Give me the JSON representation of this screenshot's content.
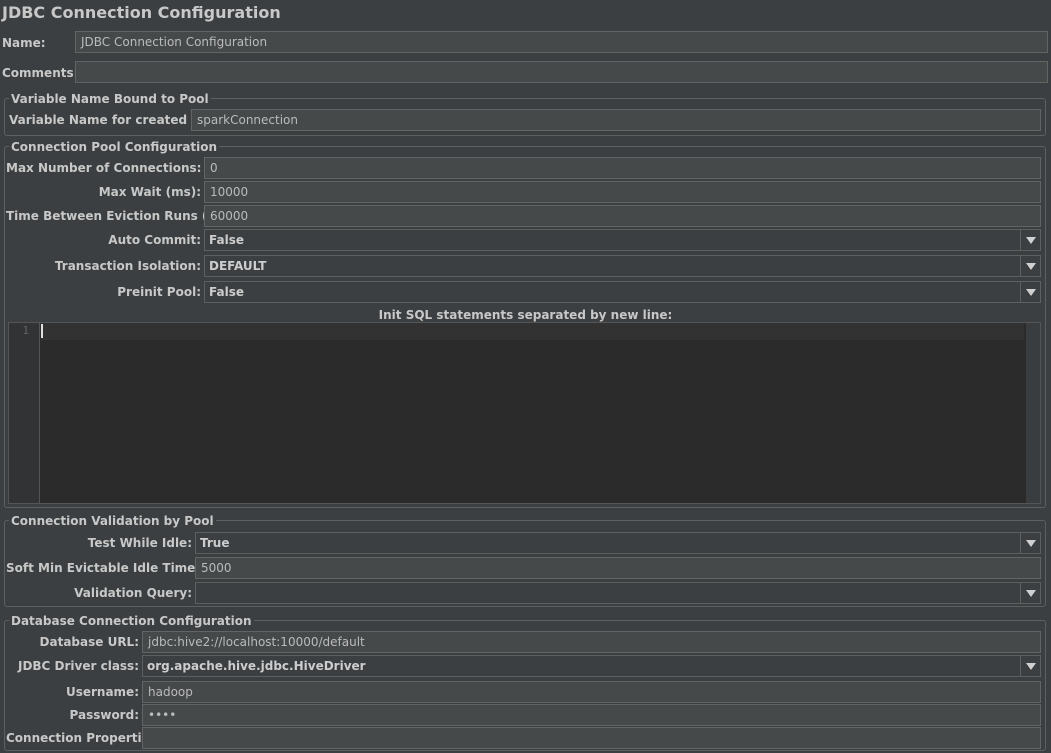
{
  "page_title": "JDBC Connection Configuration",
  "name": {
    "label": "Name:",
    "value": "JDBC Connection Configuration"
  },
  "comments": {
    "label": "Comments:",
    "value": ""
  },
  "variable_group": {
    "title": "Variable Name Bound to Pool",
    "var_label": "Variable Name for created pool:",
    "var_value": "sparkConnection"
  },
  "pool_group": {
    "title": "Connection Pool Configuration",
    "max_conn_label": "Max Number of Connections:",
    "max_conn_value": "0",
    "max_wait_label": "Max Wait (ms):",
    "max_wait_value": "10000",
    "eviction_label": "Time Between Eviction Runs (ms):",
    "eviction_value": "60000",
    "auto_commit_label": "Auto Commit:",
    "auto_commit_value": "False",
    "isolation_label": "Transaction Isolation:",
    "isolation_value": "DEFAULT",
    "preinit_label": "Preinit Pool:",
    "preinit_value": "False",
    "init_sql_label": "Init SQL statements separated by new line:",
    "init_sql_line_number": "1"
  },
  "validation_group": {
    "title": "Connection Validation by Pool",
    "test_idle_label": "Test While Idle:",
    "test_idle_value": "True",
    "soft_min_label": "Soft Min Evictable Idle Time(ms):",
    "soft_min_value": "5000",
    "validation_query_label": "Validation Query:",
    "validation_query_value": ""
  },
  "db_group": {
    "title": "Database Connection Configuration",
    "url_label": "Database URL:",
    "url_value": "jdbc:hive2://localhost:10000/default",
    "driver_label": "JDBC Driver class:",
    "driver_value": "org.apache.hive.jdbc.HiveDriver",
    "username_label": "Username:",
    "username_value": "hadoop",
    "password_label": "Password:",
    "password_value": "••••",
    "props_label": "Connection Properties:",
    "props_value": ""
  },
  "icons": {
    "dropdown": "chevron-down-icon"
  }
}
